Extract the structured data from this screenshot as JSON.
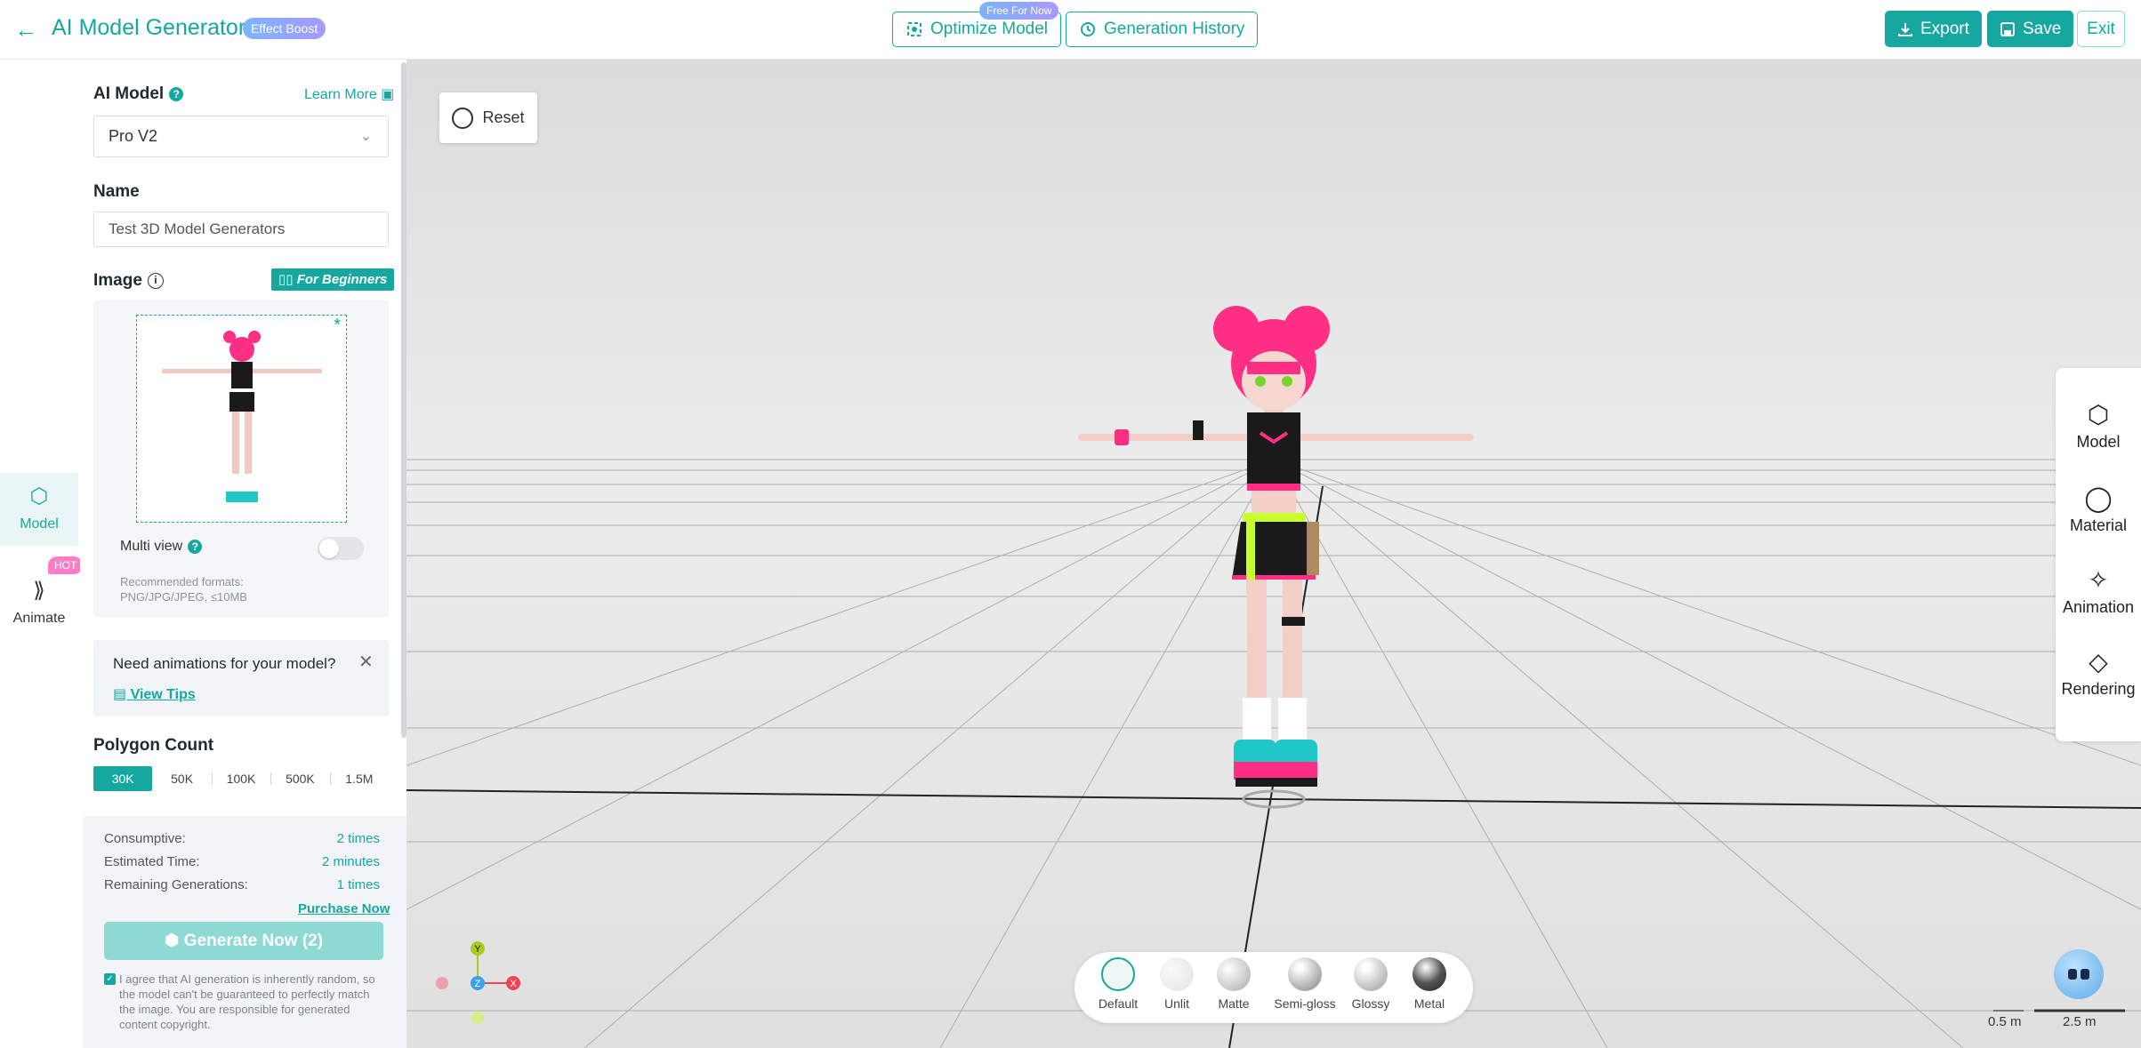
{
  "header": {
    "title": "AI Model Generator",
    "effect_badge": "Effect Boost",
    "free_badge": "Free For Now",
    "optimize_label": "Optimize Model",
    "history_label": "Generation History",
    "export_label": "Export",
    "save_label": "Save",
    "exit_label": "Exit"
  },
  "rail": {
    "model_label": "Model",
    "animate_label": "Animate",
    "hot_badge": "HOT"
  },
  "panel": {
    "ai_model_label": "AI Model",
    "learn_more": "Learn More",
    "selected_model": "Pro V2",
    "name_label": "Name",
    "name_value": "Test 3D Model Generators",
    "image_label": "Image",
    "for_beginners": "For Beginners",
    "multi_view_label": "Multi view",
    "multi_view_on": false,
    "formats_text": "Recommended formats: PNG/JPG/JPEG, ≤10MB",
    "tip_title": "Need animations for your model?",
    "tip_link": "View Tips",
    "polygon_label": "Polygon Count",
    "polygon_options": [
      "30K",
      "50K",
      "100K",
      "500K",
      "1.5M"
    ],
    "polygon_selected": "30K",
    "consumptive_label": "Consumptive:",
    "consumptive_value": "2 times",
    "time_label": "Estimated Time:",
    "time_value": "2 minutes",
    "remaining_label": "Remaining Generations:",
    "remaining_value": "1 times",
    "purchase_link": "Purchase Now",
    "generate_label": "Generate Now (2)",
    "agree_text": "I agree that AI generation is inherently random, so the model can't be guaranteed to perfectly match the image. You are responsible for generated content copyright."
  },
  "viewport": {
    "reset_label": "Reset",
    "right_tools": [
      "Model",
      "Material",
      "Animation",
      "Rendering"
    ],
    "materials": [
      "Default",
      "Unlit",
      "Matte",
      "Semi-gloss",
      "Glossy",
      "Metal"
    ],
    "material_selected": "Default",
    "scale_small": "0.5 m",
    "scale_large": "2.5 m",
    "axis_labels": {
      "y": "Y",
      "z": "Z",
      "x": "X"
    }
  },
  "colors": {
    "accent": "#16a8a0",
    "hair": "#ff2f86",
    "grid_bg": "#e4e4e4"
  }
}
